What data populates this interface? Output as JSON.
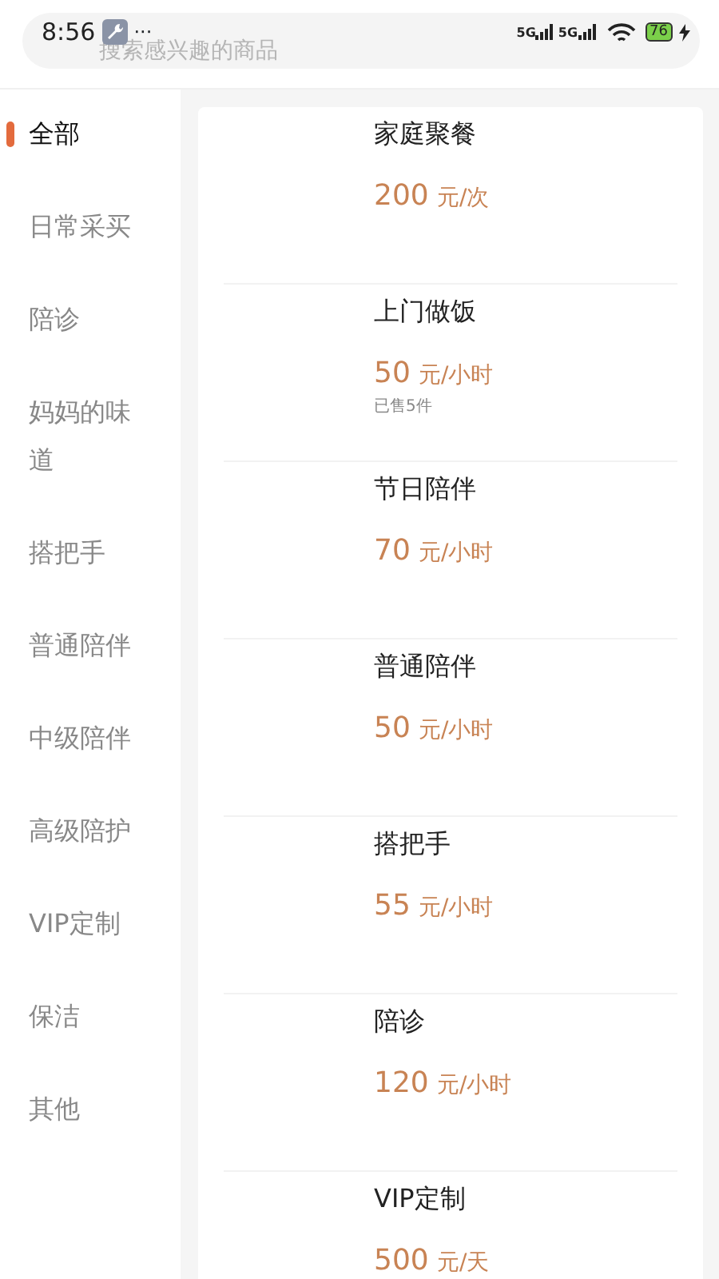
{
  "status_bar": {
    "time": "8:56",
    "dots": "···",
    "network_1": "5G",
    "network_2": "5G",
    "battery": "76"
  },
  "search": {
    "placeholder": "搜索感兴趣的商品"
  },
  "categories": [
    {
      "label": "全部",
      "selected": true
    },
    {
      "label": "日常采买",
      "selected": false
    },
    {
      "label": "陪诊",
      "selected": false
    },
    {
      "label": "妈妈的味道",
      "selected": false
    },
    {
      "label": "搭把手",
      "selected": false
    },
    {
      "label": "普通陪伴",
      "selected": false
    },
    {
      "label": "中级陪伴",
      "selected": false
    },
    {
      "label": "高级陪护",
      "selected": false
    },
    {
      "label": "VIP定制",
      "selected": false
    },
    {
      "label": "保洁",
      "selected": false
    },
    {
      "label": "其他",
      "selected": false
    }
  ],
  "products": [
    {
      "title": "家庭聚餐",
      "price": "200",
      "unit": "元/次"
    },
    {
      "title": "上门做饭",
      "price": "50",
      "unit": "元/小时",
      "sold": "已售5件"
    },
    {
      "title": "节日陪伴",
      "price": "70",
      "unit": "元/小时"
    },
    {
      "title": "普通陪伴",
      "price": "50",
      "unit": "元/小时"
    },
    {
      "title": "搭把手",
      "price": "55",
      "unit": "元/小时"
    },
    {
      "title": "陪诊",
      "price": "120",
      "unit": "元/小时"
    },
    {
      "title": "VIP定制",
      "price": "500",
      "unit": "元/天"
    }
  ]
}
